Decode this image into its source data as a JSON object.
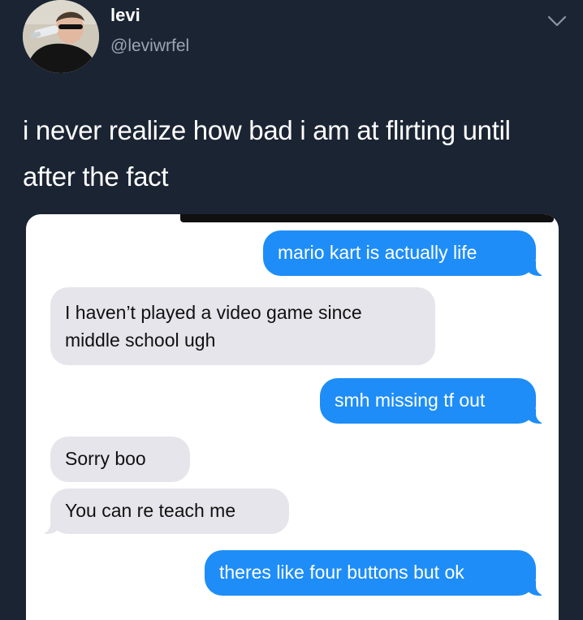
{
  "tweet": {
    "display_name": "levi",
    "handle": "@leviwrfel",
    "text": "i never realize how bad i am at flirting until after the fact",
    "menu_icon": "chevron-down-icon"
  },
  "colors": {
    "background": "#1b2433",
    "sent_bubble": "#1e8df7",
    "received_bubble": "#e6e5eb"
  },
  "messages": [
    {
      "direction": "sent",
      "text": "mario kart is actually life"
    },
    {
      "direction": "received",
      "text": "I haven’t played a video game since middle school ugh"
    },
    {
      "direction": "sent",
      "text": "smh missing tf out"
    },
    {
      "direction": "received",
      "text": "Sorry boo"
    },
    {
      "direction": "received",
      "text": "You can re teach me"
    },
    {
      "direction": "sent",
      "text": "theres like four buttons but ok"
    }
  ]
}
